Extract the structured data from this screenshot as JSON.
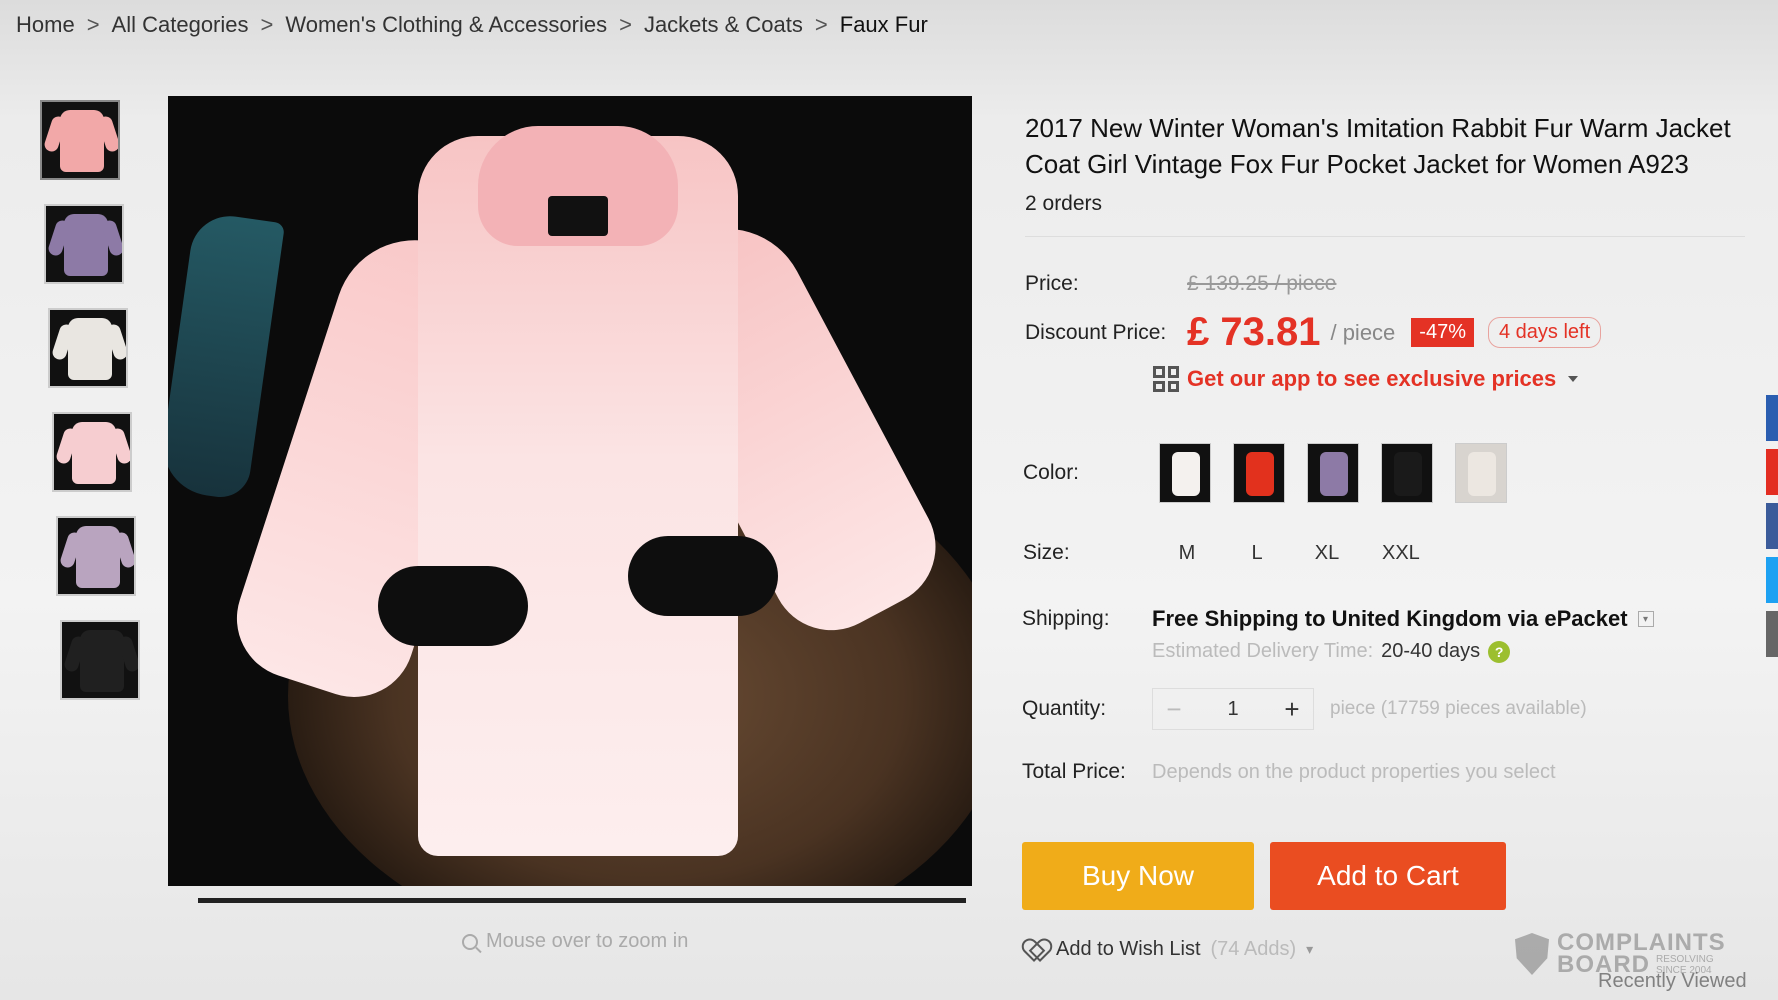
{
  "breadcrumb": {
    "items": [
      "Home",
      "All Categories",
      "Women's Clothing & Accessories",
      "Jackets & Coats"
    ],
    "current": "Faux Fur",
    "separator": ">"
  },
  "gallery": {
    "thumbnails": [
      {
        "name": "thumb-pink-coat",
        "color": "#f2a8a8"
      },
      {
        "name": "thumb-purple-coat",
        "color": "#8d7aa6"
      },
      {
        "name": "thumb-white-coat",
        "color": "#e9e6e1"
      },
      {
        "name": "thumb-pink-back",
        "color": "#f6cdd0"
      },
      {
        "name": "thumb-lavender-coat",
        "color": "#b9a4bf"
      },
      {
        "name": "thumb-black-coat",
        "color": "#202020"
      }
    ],
    "zoom_hint": "Mouse over to zoom in"
  },
  "product": {
    "title": "2017 New Winter Woman's Imitation Rabbit Fur Warm Jacket Coat Girl Vintage Fox Fur Pocket Jacket for Women A923",
    "orders": "2 orders"
  },
  "price": {
    "label": "Price:",
    "original": "£ 139.25 / piece",
    "discount_label": "Discount Price:",
    "discount_price": "£ 73.81",
    "per_piece": "/ piece",
    "discount_badge": "-47%",
    "days_left": "4 days left",
    "app_promo": "Get our app to see exclusive prices"
  },
  "color": {
    "label": "Color:",
    "options": [
      "#f4f1ee",
      "#e2311d",
      "#8d7aa6",
      "#1a1a1a",
      "#ece7e1"
    ]
  },
  "size": {
    "label": "Size:",
    "options": [
      "M",
      "L",
      "XL",
      "XXL"
    ]
  },
  "shipping": {
    "label": "Shipping:",
    "main": "Free Shipping to United Kingdom via ePacket",
    "estimated_label": "Estimated Delivery Time:",
    "estimated_value": "20-40 days",
    "help": "?"
  },
  "quantity": {
    "label": "Quantity:",
    "minus": "−",
    "value": "1",
    "plus": "+",
    "available": "piece (17759 pieces available)"
  },
  "total": {
    "label": "Total Price:",
    "text": "Depends on the product properties you select"
  },
  "actions": {
    "buy_now": "Buy Now",
    "add_to_cart": "Add to Cart",
    "wish_list": "Add to Wish List",
    "wish_adds": "(74 Adds)"
  },
  "watermark": {
    "top": "COMPLAINTS",
    "board": "BOARD",
    "resolving": "RESOLVING",
    "since": "SINCE 2004",
    "recently_viewed": "Recently Viewed"
  },
  "colors": {
    "accent_red": "#e43225",
    "buy_now": "#f0ac19",
    "add_to_cart": "#ea4d21"
  },
  "side_tabs": [
    "#2a5db0",
    "#e32d22",
    "#3b5b9a",
    "#1da1f2",
    "#666666"
  ]
}
